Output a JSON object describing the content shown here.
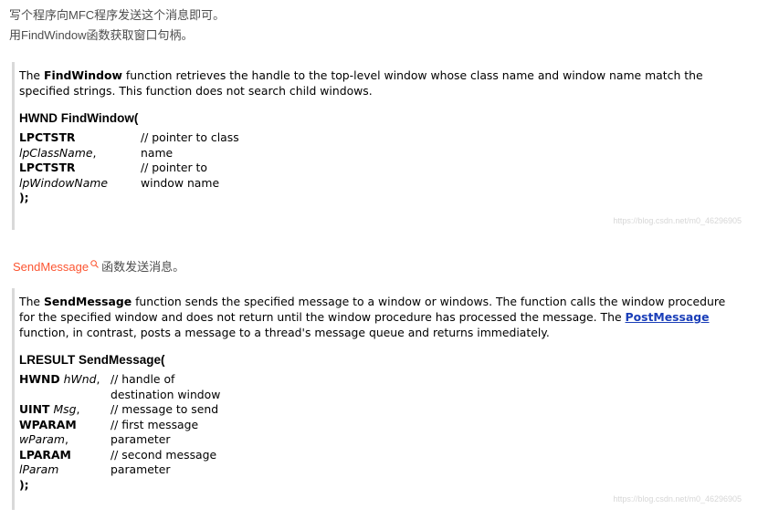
{
  "intro": {
    "line1": "写个程序向MFC程序发送这个消息即可。",
    "line2": "用FindWindow函数获取窗口句柄。"
  },
  "findwindow": {
    "desc_pre": "The ",
    "desc_name": "FindWindow",
    "desc_post": " function retrieves the handle to the top-level window whose class name and window name match the specified strings. This function does not search child windows.",
    "signature": "HWND FindWindow(",
    "params": [
      {
        "type": "LPCTSTR",
        "name": "lpClassName",
        "sep": ",",
        "comment_1": "// pointer to class",
        "comment_2": "name"
      },
      {
        "type": "LPCTSTR",
        "name": "lpWindowName",
        "sep": "",
        "comment_1": "// pointer to",
        "comment_2": "window name"
      }
    ],
    "close": ");",
    "watermark": "https://blog.csdn.net/m0_46296905"
  },
  "sendmessage_line": {
    "keyword": "SendMessage",
    "rest": "函数发送消息。",
    "icon": "search-icon"
  },
  "sendmessage": {
    "desc_pre": "The ",
    "desc_name": "SendMessage",
    "desc_mid": " function sends the specified message to a window or windows. The function calls the window procedure for the specified window and does not return until the window procedure has processed the message. The ",
    "desc_link": "PostMessage",
    "desc_post": " function, in contrast, posts a message to a thread's message queue and returns immediately.",
    "signature": "LRESULT SendMessage(",
    "params": [
      {
        "type": "HWND",
        "name": "hWnd",
        "sep": ",",
        "comment_1": "// handle of",
        "comment_2": "destination window"
      },
      {
        "type": "UINT",
        "name": "Msg",
        "sep": ",",
        "comment_1": "// message to send",
        "comment_2": ""
      },
      {
        "type": "WPARAM",
        "name": "wParam",
        "sep": ",",
        "comment_1": "// first message",
        "comment_2": "parameter"
      },
      {
        "type": "LPARAM",
        "name": "lParam",
        "sep": "",
        "comment_1": "// second message",
        "comment_2": "parameter"
      }
    ],
    "close": ");",
    "watermark": "https://blog.csdn.net/m0_46296905"
  },
  "colors": {
    "link": "#1a3eb8",
    "keyword": "#fc5531",
    "quote_border": "#d9d9d9"
  }
}
